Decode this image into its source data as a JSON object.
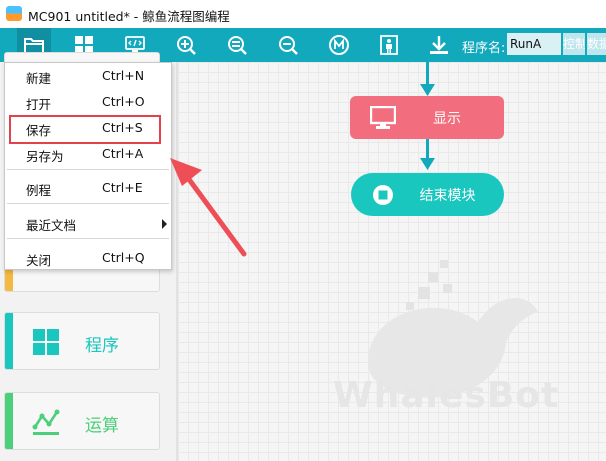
{
  "window": {
    "title": "MC901 untitled* - 鲸鱼流程图编程"
  },
  "toolbar": {
    "buttons": [
      "file-icon",
      "grid-icon",
      "monitor-code-icon",
      "zoom-in-icon",
      "zoom-fit-icon",
      "zoom-out-icon",
      "m-icon",
      "person-icon",
      "download-icon"
    ],
    "program_name_label": "程序名:",
    "program_name_value": "RunA",
    "extra_btn_1": "控制",
    "extra_btn_2": "数据"
  },
  "file_menu": {
    "items": [
      {
        "label": "新建",
        "shortcut": "Ctrl+N"
      },
      {
        "label": "打开",
        "shortcut": "Ctrl+O"
      },
      {
        "label": "保存",
        "shortcut": "Ctrl+S"
      },
      {
        "label": "另存为",
        "shortcut": "Ctrl+A"
      },
      {
        "label": "例程",
        "shortcut": "Ctrl+E"
      },
      {
        "label": "最近文档",
        "shortcut": ""
      },
      {
        "label": "关闭",
        "shortcut": "Ctrl+Q"
      }
    ]
  },
  "palette": {
    "buttons": [
      {
        "label": "程序",
        "color": "#19c7bf"
      },
      {
        "label": "运算",
        "color": "#4ccf7a"
      }
    ]
  },
  "canvas": {
    "blocks": [
      {
        "label": "显示",
        "color": "#f26d7d"
      },
      {
        "label": "结束模块",
        "color": "#19c7bf"
      }
    ],
    "watermark": "WhalesBot"
  },
  "colors": {
    "toolbar": "#12a9bd",
    "highlight": "#e2434b"
  }
}
